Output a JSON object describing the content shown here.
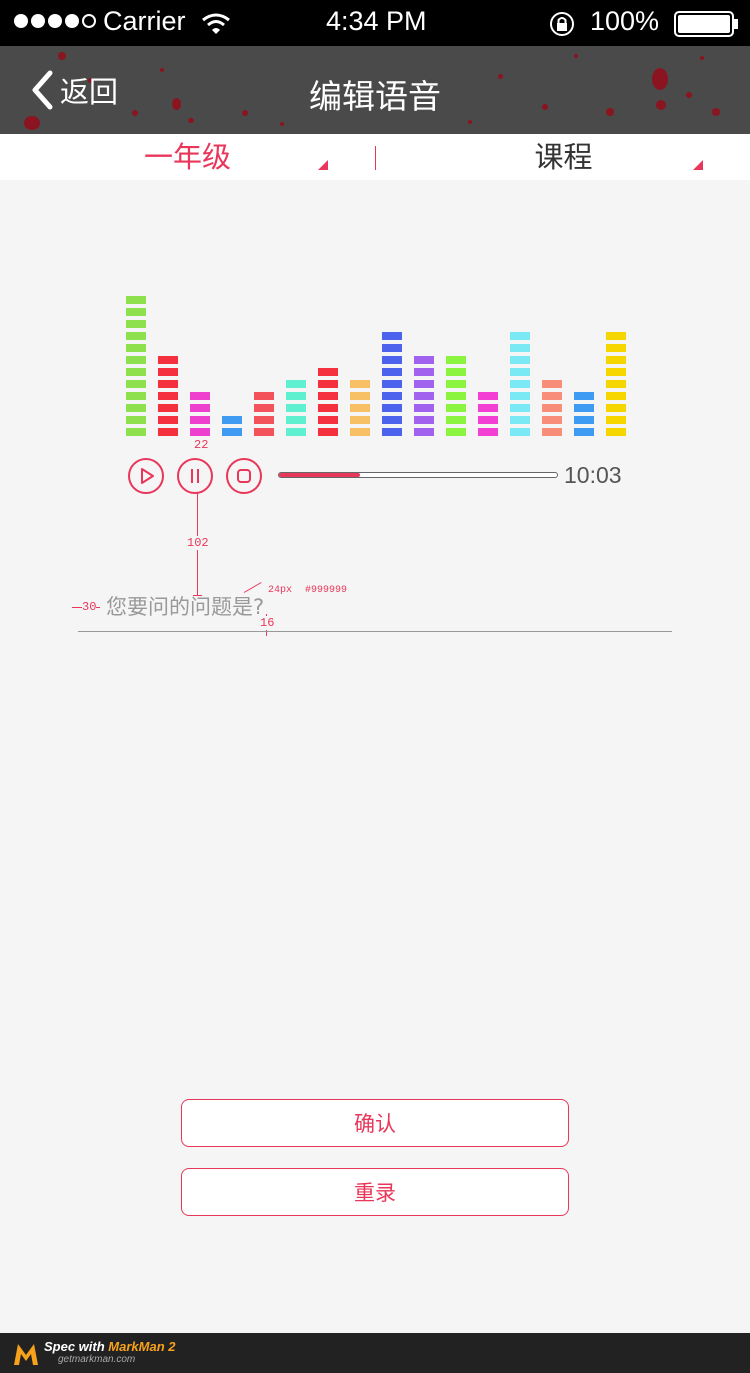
{
  "status_bar": {
    "carrier": "Carrier",
    "time": "4:34 PM",
    "battery": "100%",
    "signal_dots": 5,
    "signal_filled": 4,
    "wifi_icon": "wifi-icon",
    "lock_icon": "rotation-lock-icon",
    "battery_icon": "battery-icon"
  },
  "nav": {
    "back_label": "返回",
    "title": "编辑语音",
    "back_icon": "chevron-left-icon"
  },
  "filters": {
    "grade": "一年级",
    "course": "课程",
    "active_color": "#e8375a"
  },
  "equalizer": {
    "bars": [
      {
        "segments": 12,
        "color": "#8ee04c"
      },
      {
        "segments": 7,
        "color": "#f5303f"
      },
      {
        "segments": 4,
        "color": "#ee3fce"
      },
      {
        "segments": 2,
        "color": "#3f9bf2"
      },
      {
        "segments": 4,
        "color": "#f4525a"
      },
      {
        "segments": 5,
        "color": "#5ef0cf"
      },
      {
        "segments": 6,
        "color": "#f5303f"
      },
      {
        "segments": 5,
        "color": "#f7c064"
      },
      {
        "segments": 9,
        "color": "#4c63ee"
      },
      {
        "segments": 7,
        "color": "#a162ee"
      },
      {
        "segments": 7,
        "color": "#8bf43f"
      },
      {
        "segments": 4,
        "color": "#f43fd5"
      },
      {
        "segments": 9,
        "color": "#7ae9f4"
      },
      {
        "segments": 5,
        "color": "#f88e7a"
      },
      {
        "segments": 4,
        "color": "#3e9bf3"
      },
      {
        "segments": 9,
        "color": "#f7d600"
      }
    ]
  },
  "player": {
    "time": "10:03",
    "progress": 0.29,
    "play_icon": "play-icon",
    "pause_icon": "pause-icon",
    "stop_icon": "stop-icon"
  },
  "question": {
    "placeholder": "您要问的问题是?"
  },
  "annotations": {
    "a22": "22",
    "a102": "102",
    "a30": "30",
    "a24": "24px",
    "color": "#999999",
    "a16": "16"
  },
  "buttons": {
    "confirm": "确认",
    "rerecord": "重录"
  },
  "footer": {
    "spec_with": "Spec with ",
    "markman": "MarkMan 2",
    "url": "getmarkman.com"
  }
}
